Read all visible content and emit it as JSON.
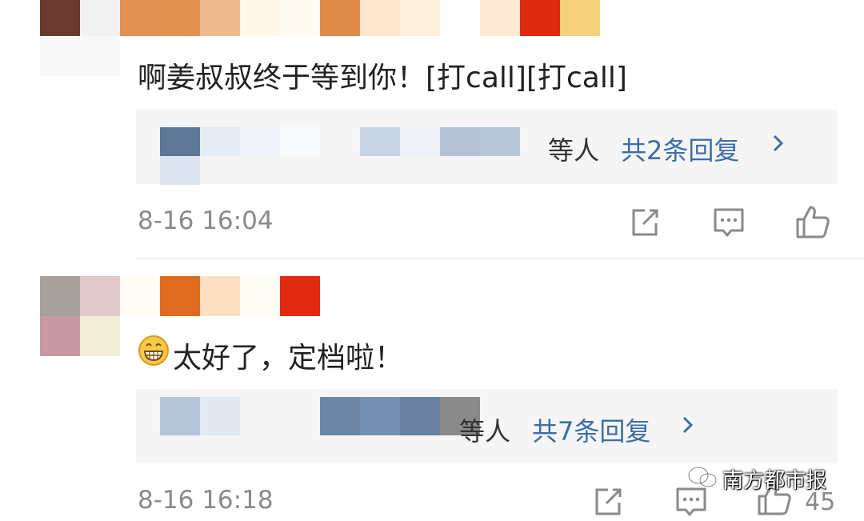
{
  "comments": [
    {
      "text": "啊姜叔叔终于等到你！[打call][打call]",
      "replies_suffix": "等人",
      "reply_count_label": "共2条回复",
      "time": "8-16 16:04"
    },
    {
      "emoji": "grinning-face",
      "text": "太好了，定档啦！",
      "replies_suffix": "等人",
      "reply_count_label": "共7条回复",
      "time": "8-16 16:18",
      "like_count": "45"
    }
  ],
  "watermark": "南方都市报",
  "colors": {
    "reply_link": "#3c6ea5",
    "reply_bg": "#f5f5f5",
    "meta_text": "#8a8a8a"
  }
}
